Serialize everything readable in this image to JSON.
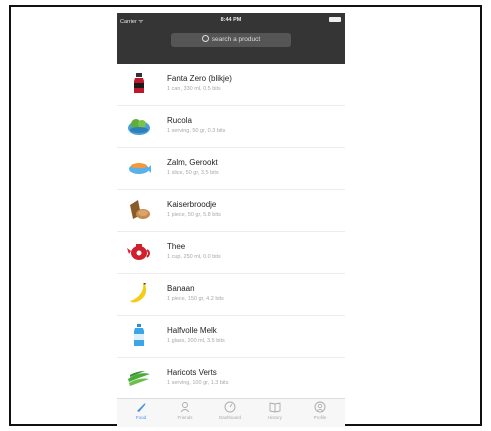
{
  "status_bar": {
    "carrier": "Carrier ᯤ",
    "time": "8:44 PM"
  },
  "search": {
    "placeholder": "search a product"
  },
  "products": [
    {
      "name": "Fanta Zero (blikje)",
      "detail": "1 can, 330 ml, 0.5 bits",
      "icon": "soda-bottle-icon"
    },
    {
      "name": "Rucola",
      "detail": "1 serving, 50 gr, 0.3 bits",
      "icon": "salad-icon"
    },
    {
      "name": "Zalm, Gerookt",
      "detail": "1 slice, 50 gr, 3.5 bits",
      "icon": "fish-icon"
    },
    {
      "name": "Kaiserbroodje",
      "detail": "1 piece, 50 gr, 5.8 bits",
      "icon": "bread-roll-icon"
    },
    {
      "name": "Thee",
      "detail": "1 cup, 250 ml, 0.0 bits",
      "icon": "teapot-icon"
    },
    {
      "name": "Banaan",
      "detail": "1 piece, 150 gr, 4.2 bits",
      "icon": "banana-icon"
    },
    {
      "name": "Halfvolle Melk",
      "detail": "1 glass, 200 ml, 3.5 bits",
      "icon": "milk-carton-icon"
    },
    {
      "name": "Haricots Verts",
      "detail": "1 serving, 100 gr, 1.3 bits",
      "icon": "green-beans-icon"
    }
  ],
  "tabs": [
    {
      "label": "Food",
      "icon": "food-icon",
      "active": true
    },
    {
      "label": "Friends",
      "icon": "friends-icon",
      "active": false
    },
    {
      "label": "Dashboard",
      "icon": "dashboard-icon",
      "active": false
    },
    {
      "label": "History",
      "icon": "history-icon",
      "active": false
    },
    {
      "label": "Profile",
      "icon": "profile-icon",
      "active": false
    }
  ],
  "colors": {
    "nav_bg": "#353535",
    "accent": "#4a90e2"
  }
}
